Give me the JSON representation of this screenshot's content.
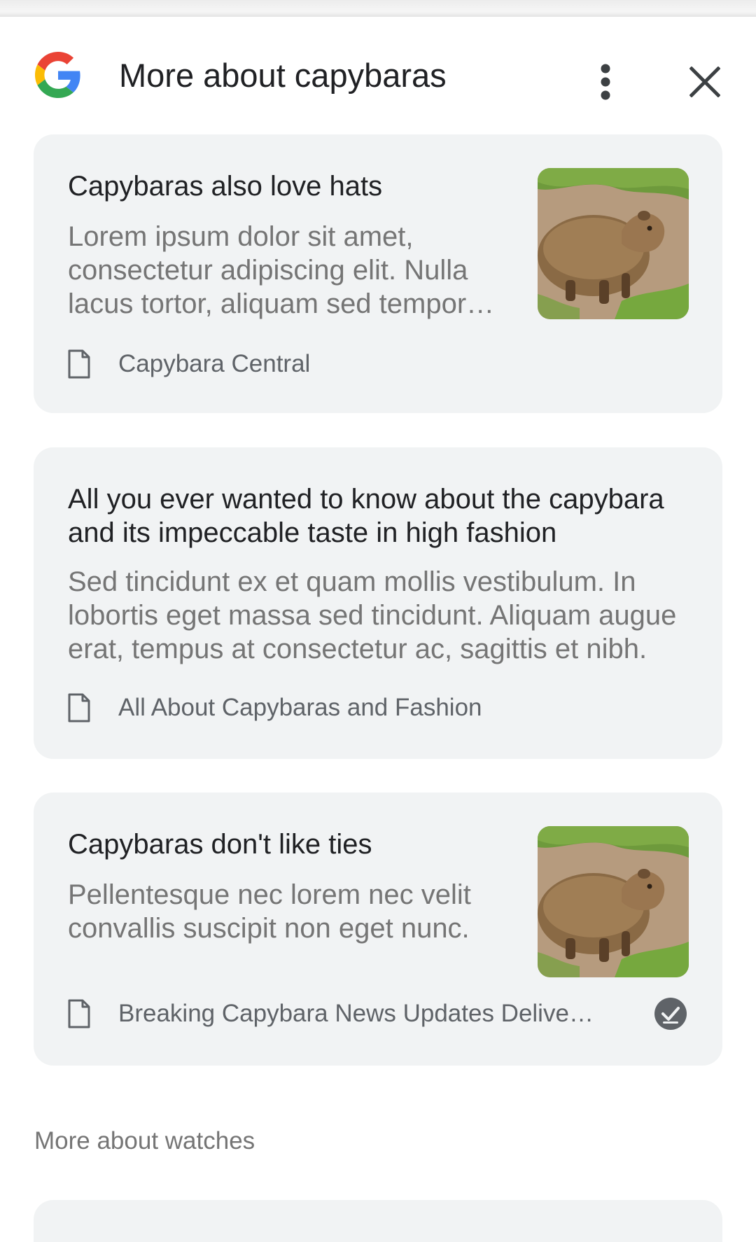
{
  "header": {
    "title": "More about capybaras",
    "logo_icon": "google-g-icon",
    "menu_icon": "more-vert-icon",
    "close_icon": "close-icon"
  },
  "cards": [
    {
      "title": "Capybaras also love hats",
      "body": "Lorem ipsum dolor sit amet, consectetur adipiscing elit. Nulla lacus tortor, aliquam sed tempor et, ultricies quis orci.",
      "source": "Capybara Central",
      "source_icon": "document-icon",
      "has_thumbnail": true
    },
    {
      "title": "All you ever wanted to know about the capybara and its impeccable taste in high fashion",
      "body": "Sed tincidunt ex et quam mollis vestibulum. In lobortis eget massa sed tincidunt. Aliquam augue erat, tempus at consectetur ac, sagittis et nibh.",
      "source": "All About Capybaras and Fashion",
      "source_icon": "document-icon",
      "has_thumbnail": false
    },
    {
      "title": "Capybaras don't like ties",
      "body": "Pellentesque nec lorem nec velit convallis suscipit non eget nunc.",
      "source": "Breaking Capybara News Updates Delivered Daily",
      "source_icon": "document-icon",
      "has_thumbnail": true,
      "status_icon": "check-circle-icon"
    }
  ],
  "section": {
    "label": "More about watches"
  },
  "colors": {
    "card_bg": "#f1f3f4",
    "title_text": "#202124",
    "body_text": "#757575",
    "google_blue": "#4285F4",
    "google_red": "#EA4335",
    "google_yellow": "#FBBC05",
    "google_green": "#34A853"
  }
}
